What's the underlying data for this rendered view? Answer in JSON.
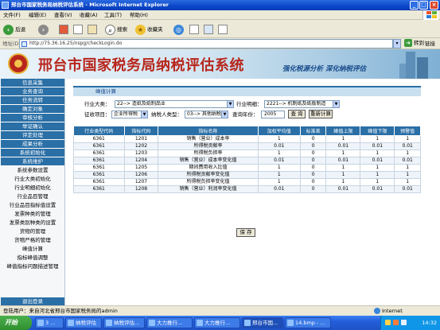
{
  "window": {
    "title": "邢台市国家税务局纳税评估系统 - Microsoft Internet Explorer"
  },
  "menu": [
    "文件(F)",
    "编辑(E)",
    "查看(V)",
    "收藏(A)",
    "工具(T)",
    "帮助(H)"
  ],
  "toolbar": {
    "back": "后退",
    "search": "搜索",
    "favorites": "收藏夹"
  },
  "address": {
    "label": "地址(D)",
    "url": "http://75.36.16.25/nspg/checkLogin.do",
    "go": "转到",
    "links": "链接"
  },
  "banner": {
    "title": "邢台市国家税务局纳税评估系统",
    "slogan": "强化税源分析 深化纳税评估"
  },
  "sidebar": {
    "items": [
      {
        "label": "信息采集",
        "type": "top"
      },
      {
        "label": "业务查询",
        "type": "top"
      },
      {
        "label": "任务流转",
        "type": "top"
      },
      {
        "label": "确定对象",
        "type": "top"
      },
      {
        "label": "审核分析",
        "type": "top"
      },
      {
        "label": "举证确认",
        "type": "top"
      },
      {
        "label": "评定处理",
        "type": "top"
      },
      {
        "label": "成果分析",
        "type": "top"
      },
      {
        "label": "系统初始化",
        "type": "top"
      },
      {
        "label": "系统维护",
        "type": "top"
      },
      {
        "label": "系统参数设置",
        "type": "sub"
      },
      {
        "label": "行业大类初始化",
        "type": "sub"
      },
      {
        "label": "行业明细初始化",
        "type": "sub"
      },
      {
        "label": "行业品目管理",
        "type": "sub"
      },
      {
        "label": "行业品目指标值设置",
        "type": "sub"
      },
      {
        "label": "发票种类的管理",
        "type": "sub"
      },
      {
        "label": "发票类别种类的设置",
        "type": "sub"
      },
      {
        "label": "货物的管理",
        "type": "sub"
      },
      {
        "label": "货物严格的管理",
        "type": "sub"
      },
      {
        "label": "峰值计算",
        "type": "sub"
      },
      {
        "label": "指标峰值调整",
        "type": "sub"
      },
      {
        "label": "峰值指标问题描述管理",
        "type": "sub"
      }
    ],
    "logout": "退出登录"
  },
  "main": {
    "section_title": "峰值计算",
    "filters": {
      "industry_major_label": "行业大类：",
      "industry_major_value": "22--> 造纸及纸制品业",
      "industry_detail_label": "行业明细：",
      "industry_detail_value": "2221--> 机制纸及纸板制造",
      "project_label": "征收项目：",
      "project_value": "企业所得税",
      "taxpayer_type_label": "纳税人类型：",
      "taxpayer_type_value": "03--> 其他纳税人",
      "year_label": "查询年份：",
      "year_value": "2005",
      "query_button": "查 询",
      "recalc_button": "重新计算"
    },
    "table": {
      "headers": [
        "行业类型代码",
        "指标代码",
        "指标名称",
        "加权平均值",
        "标准差",
        "峰值上限",
        "峰值下限",
        "预警值"
      ],
      "rows": [
        [
          "6361",
          "1201",
          "销售（营业）成本率",
          "1",
          "0",
          "1",
          "1",
          "1"
        ],
        [
          "6361",
          "1202",
          "所得税贡献率",
          "0.01",
          "0",
          "0.01",
          "0.01",
          "0.01"
        ],
        [
          "6361",
          "1203",
          "所得税负担率",
          "1",
          "0",
          "1",
          "1",
          "1"
        ],
        [
          "6361",
          "1204",
          "销售（营业）成本率变化值",
          "0.01",
          "0",
          "0.01",
          "0.01",
          "0.01"
        ],
        [
          "6361",
          "1205",
          "期间费用收入比值",
          "1",
          "0",
          "1",
          "1",
          "1"
        ],
        [
          "6361",
          "1206",
          "所得税贡献率变化值",
          "1",
          "0",
          "1",
          "1",
          "1"
        ],
        [
          "6361",
          "1207",
          "所得税负担率变化值",
          "1",
          "0",
          "1",
          "1",
          "1"
        ],
        [
          "6361",
          "1208",
          "销售（营业）利润率变化值",
          "0.01",
          "0",
          "0.01",
          "0.01",
          "0.01"
        ]
      ]
    },
    "save_button": "保 存"
  },
  "statusbar": {
    "text": "登陆用户：来自河北省邢台市国家税务局的admin",
    "zone": "Internet"
  },
  "taskbar": {
    "start": "开始",
    "tasks": [
      "3 ...",
      "纳税评估",
      "纳税评估...",
      "大力推行...",
      "大力推行...",
      "邢台市国...",
      "14.bmp - ..."
    ],
    "clock": "14:32"
  },
  "colors": {
    "nav_blue": "#2a6fa6",
    "title_red": "#b8261c",
    "slogan_blue": "#174a8b"
  }
}
